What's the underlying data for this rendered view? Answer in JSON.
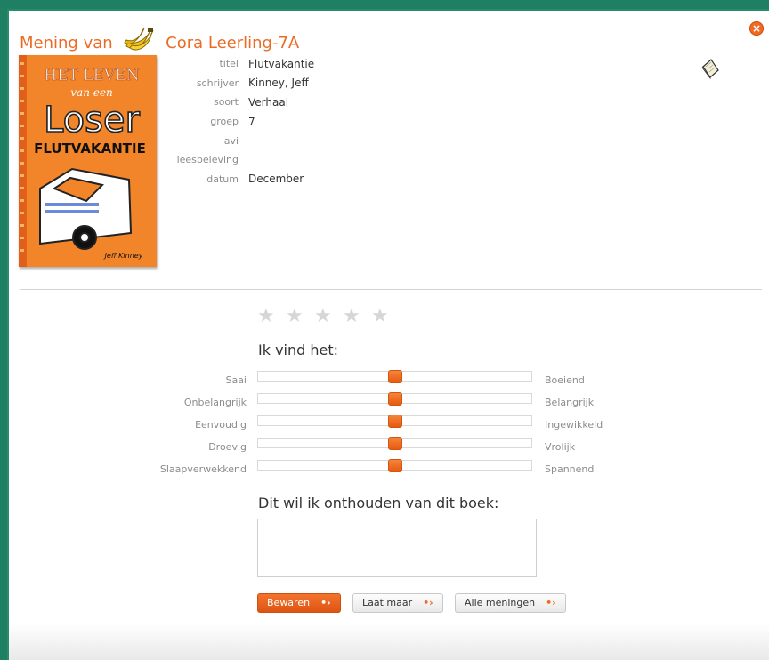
{
  "header": {
    "prefix": "Mening van",
    "student": "Cora Leerling-7A",
    "close_symbol": "×",
    "banana_icon": "banana-icon"
  },
  "book": {
    "rows": [
      {
        "label": "titel",
        "value": "Flutvakantie"
      },
      {
        "label": "schrijver",
        "value": "Kinney, Jeff"
      },
      {
        "label": "soort",
        "value": "Verhaal"
      },
      {
        "label": "groep",
        "value": "7"
      },
      {
        "label": "avi",
        "value": ""
      },
      {
        "label": "leesbeleving",
        "value": ""
      },
      {
        "label": "datum",
        "value": "December"
      }
    ],
    "cover": {
      "line1": "HET LEVEN",
      "line2": "van een",
      "line3": "Loser",
      "line4": "FLUTVAKANTIE",
      "author": "Jeff Kinney"
    }
  },
  "rating": {
    "stars": 5,
    "filled": 0
  },
  "opinion": {
    "heading": "Ik vind het:",
    "sliders": [
      {
        "left": "Saai",
        "right": "Boeiend",
        "value": 0.5
      },
      {
        "left": "Onbelangrijk",
        "right": "Belangrijk",
        "value": 0.5
      },
      {
        "left": "Eenvoudig",
        "right": "Ingewikkeld",
        "value": 0.5
      },
      {
        "left": "Droevig",
        "right": "Vrolijk",
        "value": 0.5
      },
      {
        "left": "Slaapverwekkend",
        "right": "Spannend",
        "value": 0.5
      }
    ]
  },
  "memo": {
    "heading": "Dit wil ik onthouden van dit boek:",
    "value": ""
  },
  "buttons": {
    "save": "Bewaren",
    "cancel": "Laat maar",
    "all": "Alle meningen",
    "arrow": "•›"
  },
  "colors": {
    "accent": "#ec6b24",
    "frame": "#1f7f63"
  }
}
